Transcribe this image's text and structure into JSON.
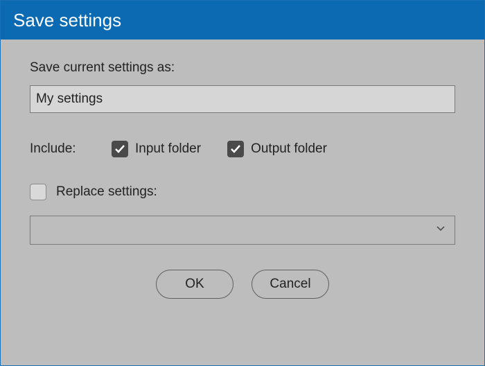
{
  "title": "Save settings",
  "saveAsLabel": "Save current settings as:",
  "settingsName": "My settings",
  "includeLabel": "Include:",
  "inputFolder": {
    "label": "Input folder",
    "checked": true
  },
  "outputFolder": {
    "label": "Output folder",
    "checked": true
  },
  "replace": {
    "label": "Replace settings:",
    "checked": false
  },
  "replaceSelection": "",
  "buttons": {
    "ok": "OK",
    "cancel": "Cancel"
  }
}
